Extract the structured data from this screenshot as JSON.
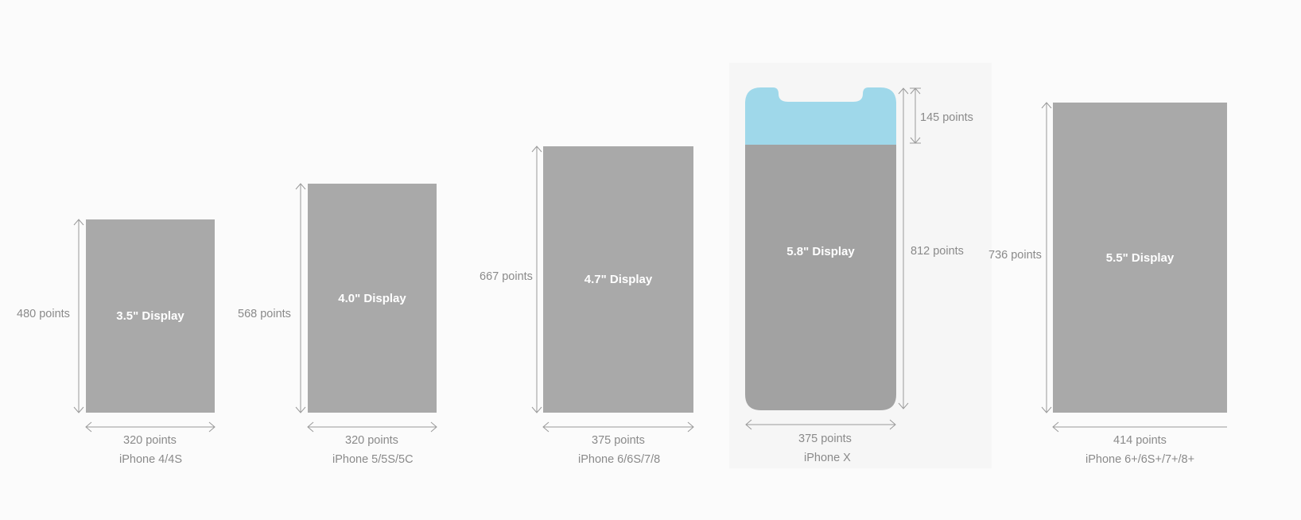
{
  "devices": [
    {
      "display": "3.5\" Display",
      "width": "320 points",
      "height": "480 points",
      "model": "iPhone 4/4S"
    },
    {
      "display": "4.0\" Display",
      "width": "320 points",
      "height": "568 points",
      "model": "iPhone 5/5S/5C"
    },
    {
      "display": "4.7\" Display",
      "width": "375 points",
      "height": "667 points",
      "model": "iPhone 6/6S/7/8"
    },
    {
      "display": "5.8\" Display",
      "width": "375 points",
      "height": "812 points",
      "safe_area": "145 points",
      "model": "iPhone X"
    },
    {
      "display": "5.5\" Display",
      "width": "414 points",
      "height": "736 points",
      "model": "iPhone 6+/6S+/7+/8+"
    }
  ],
  "colors": {
    "screen": "#a9a9a9",
    "sensor_housing": "#9fd8ea",
    "dimension_line": "#9a9a9a",
    "label_text": "#8a8a8a"
  }
}
